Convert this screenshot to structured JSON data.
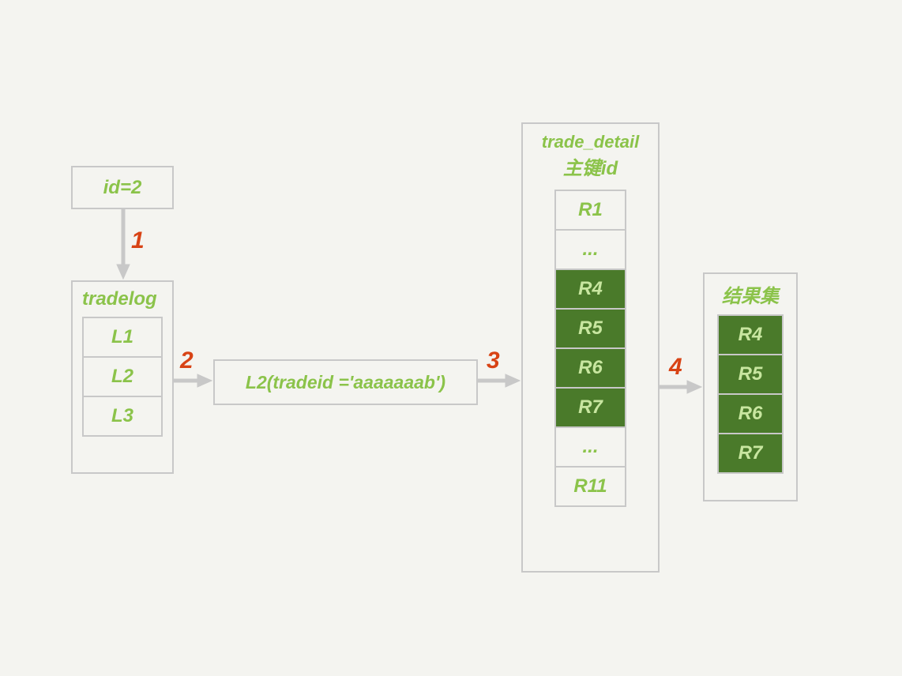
{
  "id_box": {
    "label": "id=2"
  },
  "steps": {
    "s1": "1",
    "s2": "2",
    "s3": "3",
    "s4": "4"
  },
  "tradelog": {
    "title": "tradelog",
    "rows": [
      "L1",
      "L2",
      "L3"
    ]
  },
  "lookup": {
    "label": "L2(tradeid ='aaaaaaab')"
  },
  "trade_detail": {
    "title_line1": "trade_detail",
    "title_line2": "主键id",
    "rows": [
      {
        "label": "R1",
        "hl": false
      },
      {
        "label": "...",
        "hl": false
      },
      {
        "label": "R4",
        "hl": true
      },
      {
        "label": "R5",
        "hl": true
      },
      {
        "label": "R6",
        "hl": true
      },
      {
        "label": "R7",
        "hl": true
      },
      {
        "label": "...",
        "hl": false
      },
      {
        "label": "R11",
        "hl": false
      }
    ]
  },
  "result": {
    "title": "结果集",
    "rows": [
      "R4",
      "R5",
      "R6",
      "R7"
    ]
  }
}
